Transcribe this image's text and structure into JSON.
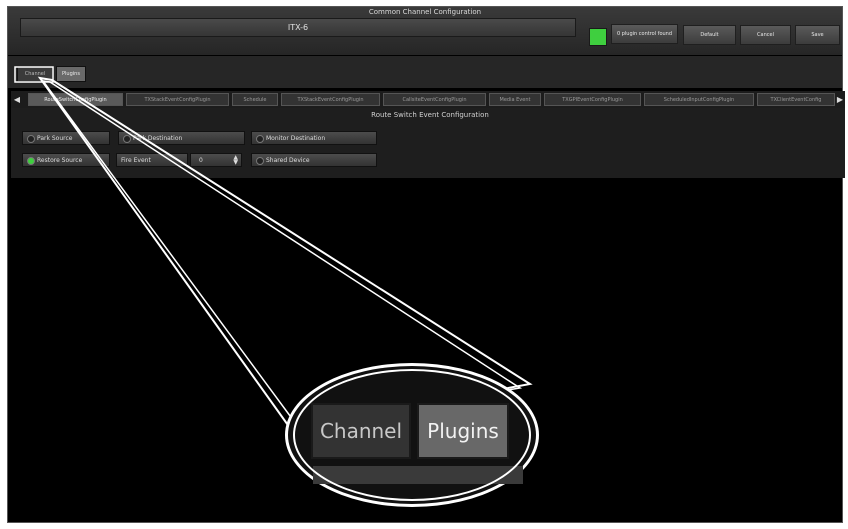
{
  "header": {
    "title": "Common Channel Configuration",
    "channel_name": "ITX-6",
    "status_color": "#3fcf3f",
    "plugin_control_found": "0 plugin control found",
    "buttons": {
      "default": "Default",
      "cancel": "Cancel",
      "save": "Save"
    }
  },
  "top_tabs": {
    "channel": "Channel",
    "plugins": "Plugins"
  },
  "plugin_tabs": [
    "RouteSwitchConfigPlugin",
    "TXStackEventConfigPlugin",
    "Schedule",
    "TXStackEventConfigPlugin",
    "CallsiteEventConfigPlugin",
    "Media Event",
    "TXGPIEventConfigPlugin",
    "ScheduledInputConfigPlugin",
    "TXClientEventConfig"
  ],
  "section": {
    "title": "Route Switch Event Configuration",
    "controls": {
      "park_source": "Park Source",
      "park_destination": "Park Destination",
      "monitor_destination": "Monitor Destination",
      "restore_source": "Restore Source",
      "fire_event": "Fire Event",
      "fire_value": "0",
      "shared_device": "Shared Device"
    }
  },
  "zoom": {
    "channel": "Channel",
    "plugins": "Plugins"
  }
}
